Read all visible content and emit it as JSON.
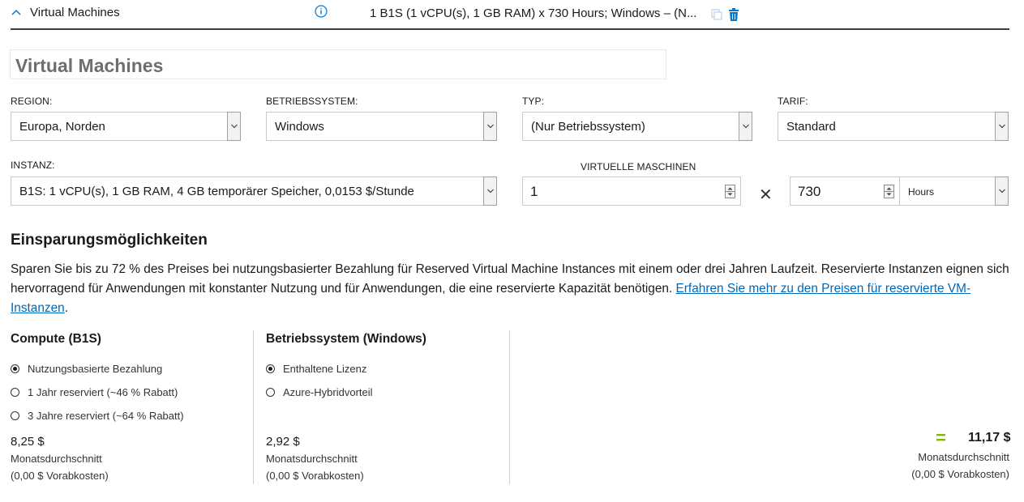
{
  "header": {
    "title": "Virtual Machines",
    "summary": "1 B1S (1 vCPU(s), 1 GB RAM) x 730 Hours; Windows – (N...",
    "colors": {
      "accent": "#0078d4",
      "trash": "#0078d4",
      "copy_disabled": "#b8d3ee"
    }
  },
  "name_input": {
    "value": "Virtual Machines"
  },
  "fields": {
    "region": {
      "label": "REGION:",
      "value": "Europa, Norden"
    },
    "os": {
      "label": "BETRIEBSSYSTEM:",
      "value": "Windows"
    },
    "type": {
      "label": "TYP:",
      "value": "(Nur Betriebssystem)"
    },
    "tier": {
      "label": "TARIF:",
      "value": "Standard"
    },
    "instance": {
      "label": "INSTANZ:",
      "value": "B1S: 1 vCPU(s), 1 GB RAM, 4 GB temporärer Speicher, 0,0153 $/Stunde"
    },
    "vm_count": {
      "label": "VIRTUELLE MASCHINEN",
      "value": "1"
    },
    "hours": {
      "value": "730",
      "unit": "Hours"
    }
  },
  "savings": {
    "title": "Einsparungsmöglichkeiten",
    "text": "Sparen Sie bis zu 72 % des Preises bei nutzungsbasierter Bezahlung für Reserved Virtual Machine Instances mit einem oder drei Jahren Laufzeit. Reservierte Instanzen eignen sich hervorragend für Anwendungen mit konstanter Nutzung und für Anwendungen, die eine reservierte Kapazität benötigen. ",
    "link": "Erfahren Sie mehr zu den Preisen für reservierte VM-Instanzen",
    "link_suffix": "."
  },
  "compute": {
    "title": "Compute (B1S)",
    "options": [
      {
        "label": "Nutzungsbasierte Bezahlung",
        "selected": true
      },
      {
        "label": "1 Jahr reserviert (~46 % Rabatt)",
        "selected": false
      },
      {
        "label": "3 Jahre reserviert (~64 % Rabatt)",
        "selected": false
      }
    ],
    "price": "8,25 $",
    "price_note": "Monatsdurchschnitt",
    "upfront": "(0,00 $ Vorabkosten)"
  },
  "os_license": {
    "title": "Betriebssystem (Windows)",
    "options": [
      {
        "label": "Enthaltene Lizenz",
        "selected": true
      },
      {
        "label": "Azure-Hybridvorteil",
        "selected": false
      }
    ],
    "price": "2,92 $",
    "price_note": "Monatsdurchschnitt",
    "upfront": "(0,00 $ Vorabkosten)"
  },
  "total": {
    "equals": "=",
    "value": "11,17 $",
    "note": "Monatsdurchschnitt",
    "upfront": "(0,00 $ Vorabkosten)",
    "color": "#7fba00"
  }
}
